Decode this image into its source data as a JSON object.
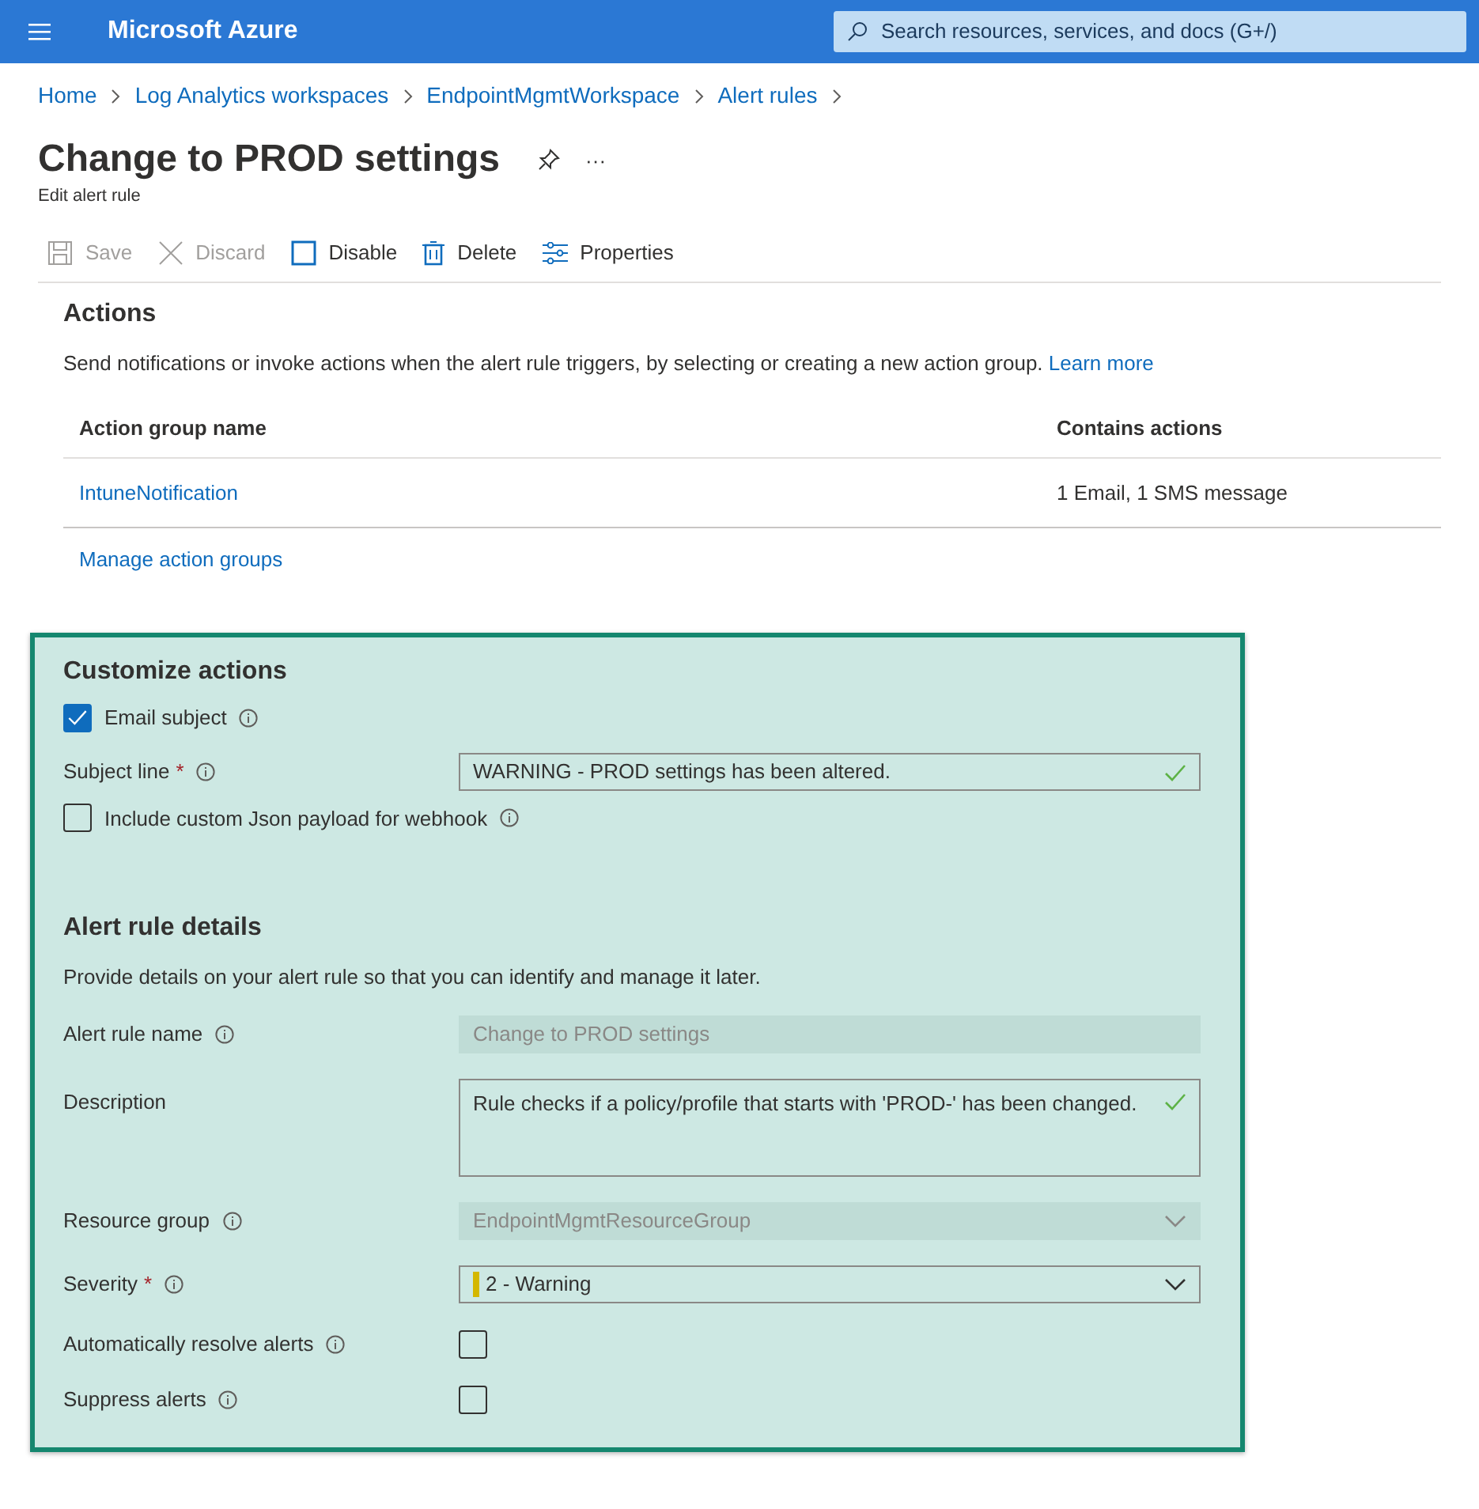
{
  "header": {
    "title": "Microsoft Azure",
    "search_placeholder": "Search resources, services, and docs (G+/)"
  },
  "breadcrumbs": [
    "Home",
    "Log Analytics workspaces",
    "EndpointMgmtWorkspace",
    "Alert rules"
  ],
  "page": {
    "title": "Change to PROD settings",
    "subtitle": "Edit alert rule",
    "more": "···"
  },
  "toolbar": [
    {
      "kind": "save",
      "label": "Save",
      "disabled": true
    },
    {
      "kind": "discard",
      "label": "Discard",
      "disabled": true
    },
    {
      "kind": "disable",
      "label": "Disable",
      "disabled": false
    },
    {
      "kind": "delete",
      "label": "Delete",
      "disabled": false
    },
    {
      "kind": "properties",
      "label": "Properties",
      "disabled": false
    }
  ],
  "actions": {
    "heading": "Actions",
    "description": "Send notifications or invoke actions when the alert rule triggers, by selecting or creating a new action group.",
    "learn_more": "Learn more",
    "columns": [
      "Action group name",
      "Contains actions"
    ],
    "rows": [
      {
        "name": "IntuneNotification",
        "contains": "1 Email, 1 SMS message"
      }
    ],
    "manage_link": "Manage action groups"
  },
  "customize": {
    "heading": "Customize actions",
    "fields": [
      {
        "kind": "checkbox",
        "label": "Email subject",
        "info": true,
        "checked": true
      },
      {
        "kind": "text",
        "label": "Subject line",
        "required_mark": "*",
        "info": true,
        "value": "WARNING - PROD settings has been altered.",
        "valid": true
      },
      {
        "kind": "checkbox",
        "label": "Include custom Json payload for webhook",
        "info": true,
        "checked": false
      }
    ]
  },
  "details": {
    "heading": "Alert rule details",
    "description": "Provide details on your alert rule so that you can identify and manage it later.",
    "fields": [
      {
        "kind": "text",
        "label": "Alert rule name",
        "info": true,
        "value": "Change to PROD settings",
        "disabled": true
      },
      {
        "kind": "textarea",
        "label": "Description",
        "info": false,
        "value": "Rule checks if a policy/profile that starts with 'PROD-' has been changed.",
        "valid": true
      },
      {
        "kind": "select",
        "label": "Resource group",
        "info": true,
        "value": "EndpointMgmtResourceGroup",
        "disabled": true
      },
      {
        "kind": "select",
        "label": "Severity",
        "info": true,
        "required_mark": "*",
        "value": "2 - Warning",
        "disabled": false,
        "color": "#d4b700"
      },
      {
        "kind": "toggle-check",
        "label": "Automatically resolve alerts",
        "info": true,
        "checked": false
      },
      {
        "kind": "toggle-check",
        "label": "Suppress alerts",
        "info": true,
        "checked": false
      }
    ]
  }
}
